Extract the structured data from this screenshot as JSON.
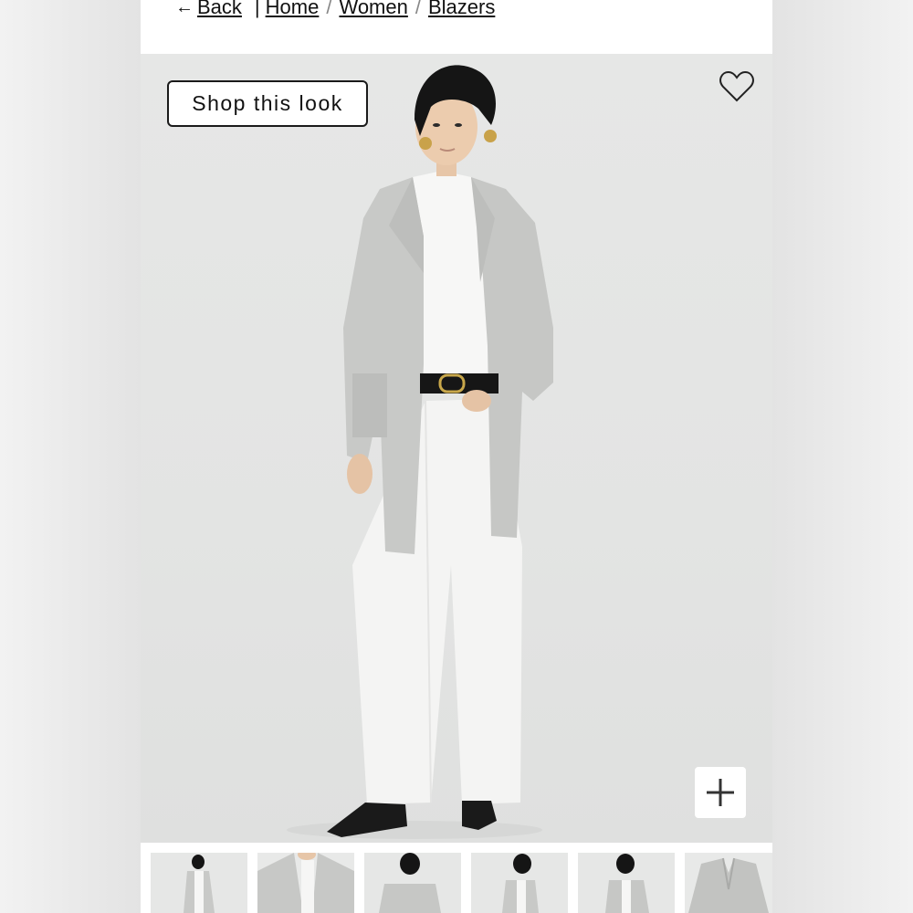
{
  "breadcrumb": {
    "back_label": "Back",
    "items": [
      "Home",
      "Women",
      "Blazers"
    ],
    "separator": "/"
  },
  "hero": {
    "shop_label": "Shop this look",
    "favorite_icon": "heart-icon",
    "zoom_icon": "plus-icon"
  },
  "thumbnails": [
    {
      "name": "thumbnail-full-look"
    },
    {
      "name": "thumbnail-detail-front"
    },
    {
      "name": "thumbnail-back-view"
    },
    {
      "name": "thumbnail-side-view"
    },
    {
      "name": "thumbnail-three-quarter-view"
    },
    {
      "name": "thumbnail-product-flat"
    }
  ],
  "colors": {
    "page_bg": "#ffffff",
    "hero_bg": "#e4e5e4",
    "cardigan": "#c9cac8",
    "text": "#111111"
  }
}
